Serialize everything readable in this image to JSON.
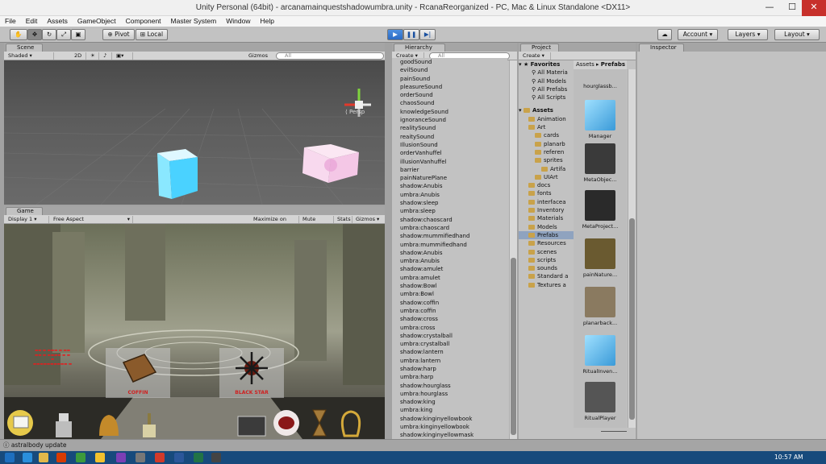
{
  "window": {
    "title": "Unity Personal (64bit) - arcanamainquestshadowumbra.unity - RcanaReorganized - PC, Mac & Linux Standalone <DX11>",
    "min": "—",
    "max": "☐",
    "close": "✕"
  },
  "menu": [
    "File",
    "Edit",
    "Assets",
    "GameObject",
    "Component",
    "Master System",
    "Window",
    "Help"
  ],
  "toolbar": {
    "pivot": "Pivot",
    "local": "Local",
    "account": "Account",
    "layers": "Layers",
    "layout": "Layout"
  },
  "scene": {
    "tab": "Scene",
    "shading": "Shaded",
    "mode2d": "2D",
    "gizmos": "Gizmos",
    "search": "All",
    "persp": "Persp"
  },
  "game": {
    "tab": "Game",
    "display": "Display 1",
    "aspect": "Free Aspect",
    "maximize": "Maximize on Play",
    "mute": "Mute audio",
    "stats": "Stats",
    "gizmos": "Gizmos",
    "card1": "COFFIN",
    "card2": "BLACK STAR"
  },
  "hierarchy": {
    "tab": "Hierarchy",
    "create": "Create",
    "search": "All",
    "items": [
      "goodSound",
      "evilSound",
      "painSound",
      "pleasureSound",
      "orderSound",
      "chaosSound",
      "knowledgeSound",
      "ignoranceSound",
      "realitySound",
      "reaitySound",
      "IllusionSound",
      "orderVanhuffel",
      "illusionVanhuffel",
      "barrier",
      "painNaturePlane",
      "shadow:Anubis",
      "umbra:Anubis",
      "shadow:sleep",
      "umbra:sleep",
      "shadow:chaoscard",
      "umbra:chaoscard",
      "shadow:mummifiedhand",
      "umbra:mummifiedhand",
      "shadow:Anubis",
      "umbra:Anubis",
      "shadow:amulet",
      "umbra:amulet",
      "shadow:Bowl",
      "umbra:Bowl",
      "shadow:coffin",
      "umbra:coffin",
      "shadow:cross",
      "umbra:cross",
      "shadow:crystalball",
      "umbra:crystalball",
      "shadow:lantern",
      "umbra:lantern",
      "shadow:harp",
      "umbra:harp",
      "shadow:hourglass",
      "umbra:hourglass",
      "shadow:king",
      "umbra:king",
      "shadow:kinginyellowbook",
      "umbra:kinginyellowbook",
      "shadow:kinginyellowmask"
    ]
  },
  "project": {
    "tab": "Project",
    "create": "Create",
    "breadcrumb": [
      "Assets",
      "Prefabs"
    ],
    "favorites": {
      "label": "Favorites",
      "items": [
        "All Materia",
        "All Models",
        "All Prefabs",
        "All Scripts"
      ]
    },
    "assets_label": "Assets",
    "tree": [
      {
        "l": "Animation",
        "d": 1
      },
      {
        "l": "Art",
        "d": 1
      },
      {
        "l": "cards",
        "d": 2
      },
      {
        "l": "planarb",
        "d": 2
      },
      {
        "l": "referen",
        "d": 2
      },
      {
        "l": "sprites",
        "d": 2
      },
      {
        "l": "Artifa",
        "d": 3
      },
      {
        "l": "UIArt",
        "d": 2
      },
      {
        "l": "docs",
        "d": 1
      },
      {
        "l": "fonts",
        "d": 1
      },
      {
        "l": "interfacea",
        "d": 1
      },
      {
        "l": "Inventory",
        "d": 1
      },
      {
        "l": "Materials",
        "d": 1
      },
      {
        "l": "Models",
        "d": 1
      },
      {
        "l": "Prefabs",
        "d": 1
      },
      {
        "l": "Resources",
        "d": 1
      },
      {
        "l": "scenes",
        "d": 1
      },
      {
        "l": "scripts",
        "d": 1
      },
      {
        "l": "sounds",
        "d": 1
      },
      {
        "l": "Standard a",
        "d": 1
      },
      {
        "l": "Textures a",
        "d": 1
      }
    ],
    "assets": [
      "hourglassb...",
      "Manager",
      "MetaObjec...",
      "MetaProject...",
      "painNature...",
      "planarback...",
      "RitualInven...",
      "RitualPlayer"
    ]
  },
  "inspector": {
    "tab": "Inspector"
  },
  "status": "astralbody update",
  "clock": "10:57 AM"
}
